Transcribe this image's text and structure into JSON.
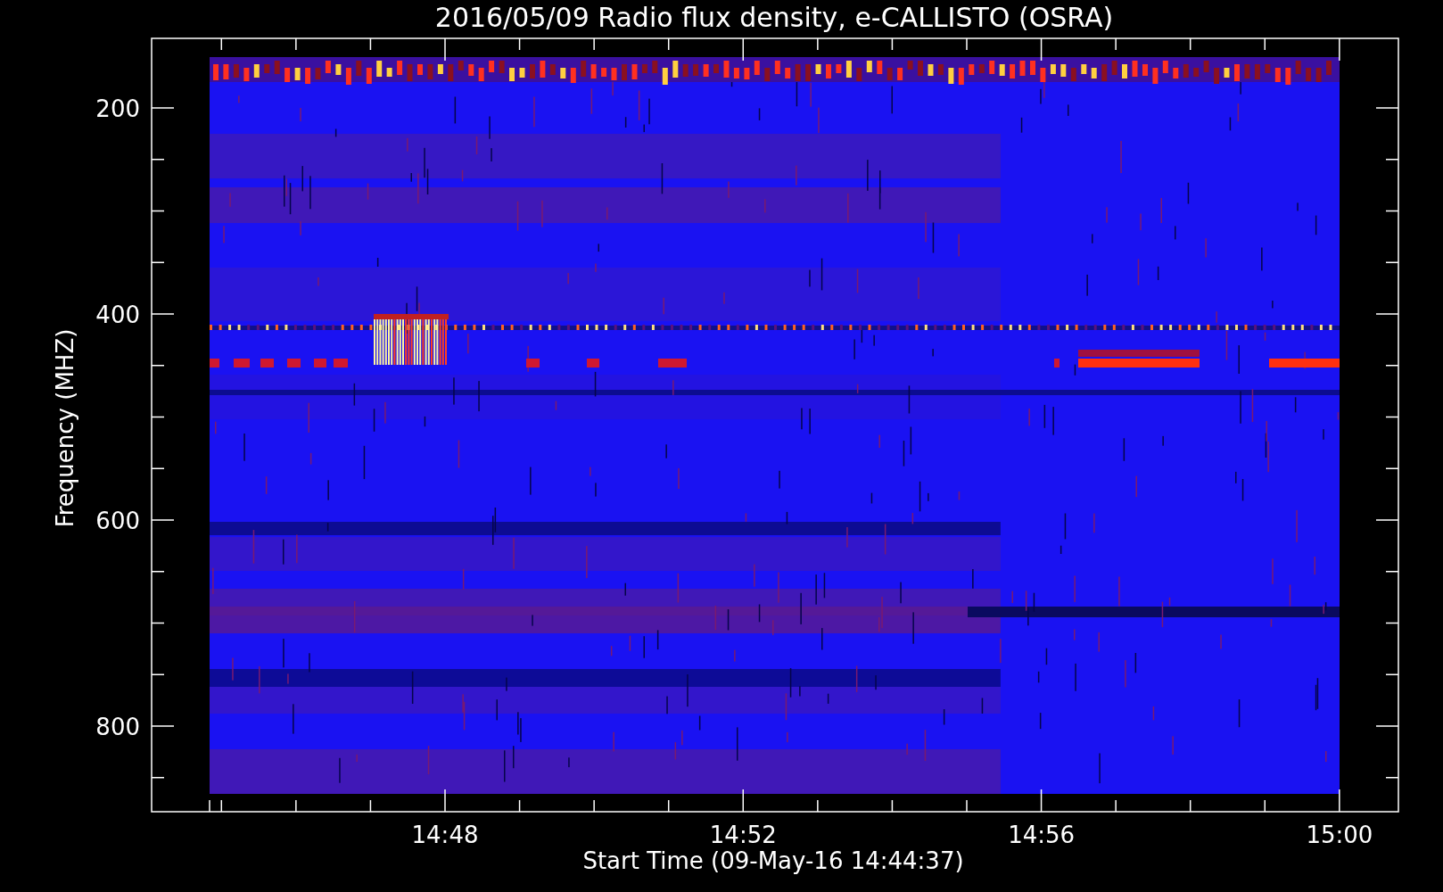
{
  "title": "2016/05/09  Radio flux density, e-CALLISTO (OSRA)",
  "y_axis": {
    "label": "Frequency (MHZ)",
    "tick_labels": [
      "200",
      "400",
      "600",
      "800"
    ]
  },
  "x_axis": {
    "label": "Start Time (09-May-16 14:44:37)",
    "tick_labels": [
      "14:48",
      "14:52",
      "14:56",
      "15:00"
    ]
  }
}
